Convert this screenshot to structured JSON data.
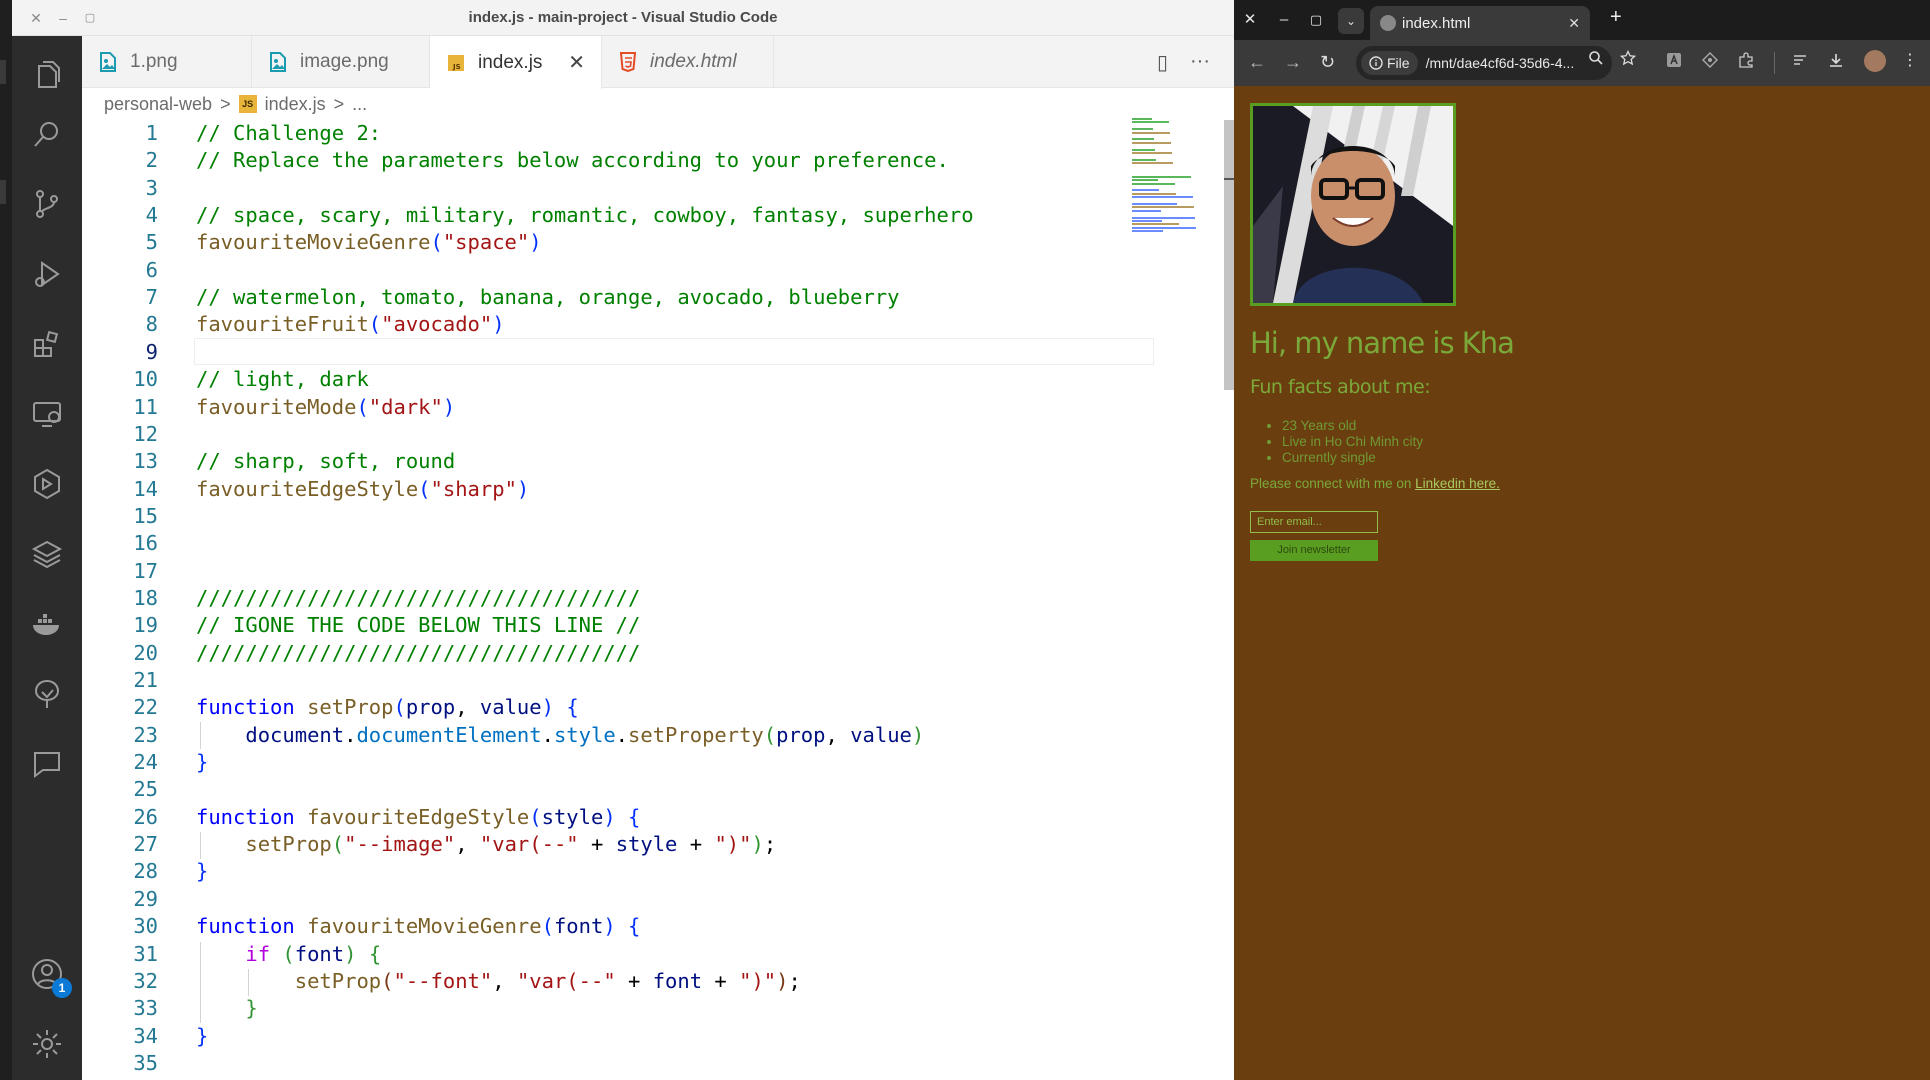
{
  "window": {
    "title": "index.js - main-project - Visual Studio Code",
    "controls": {
      "close": "✕",
      "minimize": "–",
      "maximize": "▢"
    }
  },
  "activity_bar": {
    "icons": [
      "files-icon",
      "search-icon",
      "source-control-icon",
      "run-debug-icon",
      "extensions-icon",
      "remote-explorer-icon",
      "testing-icon",
      "layers-icon",
      "docker-icon",
      "tree-icon",
      "chat-icon"
    ],
    "account_badge": "1"
  },
  "tabs": [
    {
      "label": "1.png",
      "icon": "image-file-icon",
      "active": false,
      "italic": false
    },
    {
      "label": "image.png",
      "icon": "image-file-icon",
      "active": false,
      "italic": false
    },
    {
      "label": "index.js",
      "icon": "js-file-icon",
      "active": true,
      "italic": false,
      "close": "✕"
    },
    {
      "label": "index.html",
      "icon": "html-file-icon",
      "active": false,
      "italic": true
    }
  ],
  "tab_actions": {
    "split": "▯",
    "more": "···"
  },
  "breadcrumb": {
    "folder": "personal-web",
    "file": "index.js",
    "rest": "...",
    "sep": ">",
    "js_badge": "JS"
  },
  "editor": {
    "current_line": 9,
    "lines": [
      {
        "n": "1",
        "html": "<span class='c-com'>// Challenge 2:</span>"
      },
      {
        "n": "2",
        "html": "<span class='c-com'>// Replace the parameters below according to your preference.</span>"
      },
      {
        "n": "3",
        "html": ""
      },
      {
        "n": "4",
        "html": "<span class='c-com'>// space, scary, military, romantic, cowboy, fantasy, superhero</span>"
      },
      {
        "n": "5",
        "html": "<span class='c-fn'>favouriteMovieGenre</span><span class='c-b1'>(</span><span class='c-str'>\"space\"</span><span class='c-b1'>)</span>"
      },
      {
        "n": "6",
        "html": ""
      },
      {
        "n": "7",
        "html": "<span class='c-com'>// watermelon, tomato, banana, orange, avocado, blueberry</span>"
      },
      {
        "n": "8",
        "html": "<span class='c-fn'>favouriteFruit</span><span class='c-b1'>(</span><span class='c-str'>\"avocado\"</span><span class='c-b1'>)</span>"
      },
      {
        "n": "9",
        "html": ""
      },
      {
        "n": "10",
        "html": "<span class='c-com'>// light, dark</span>"
      },
      {
        "n": "11",
        "html": "<span class='c-fn'>favouriteMode</span><span class='c-b1'>(</span><span class='c-str'>\"dark\"</span><span class='c-b1'>)</span>"
      },
      {
        "n": "12",
        "html": ""
      },
      {
        "n": "13",
        "html": "<span class='c-com'>// sharp, soft, round</span>"
      },
      {
        "n": "14",
        "html": "<span class='c-fn'>favouriteEdgeStyle</span><span class='c-b1'>(</span><span class='c-str'>\"sharp\"</span><span class='c-b1'>)</span>"
      },
      {
        "n": "15",
        "html": ""
      },
      {
        "n": "16",
        "html": ""
      },
      {
        "n": "17",
        "html": ""
      },
      {
        "n": "18",
        "html": "<span class='c-com'>////////////////////////////////////</span>"
      },
      {
        "n": "19",
        "html": "<span class='c-com'>// IGONE THE CODE BELOW THIS LINE //</span>"
      },
      {
        "n": "20",
        "html": "<span class='c-com'>////////////////////////////////////</span>"
      },
      {
        "n": "21",
        "html": ""
      },
      {
        "n": "22",
        "html": "<span class='c-kw'>function</span> <span class='c-fn'>setProp</span><span class='c-b1'>(</span><span class='c-var'>prop</span>, <span class='c-var'>value</span><span class='c-b1'>)</span> <span class='c-b1'>{</span>"
      },
      {
        "n": "23",
        "html": "    <span class='c-var'>document</span>.<span class='c-prop'>documentElement</span>.<span class='c-prop'>style</span>.<span class='c-fn'>setProperty</span><span class='c-b2'>(</span><span class='c-var'>prop</span>, <span class='c-var'>value</span><span class='c-b2'>)</span>"
      },
      {
        "n": "24",
        "html": "<span class='c-b1'>}</span>"
      },
      {
        "n": "25",
        "html": ""
      },
      {
        "n": "26",
        "html": "<span class='c-kw'>function</span> <span class='c-fn'>favouriteEdgeStyle</span><span class='c-b1'>(</span><span class='c-var'>style</span><span class='c-b1'>)</span> <span class='c-b1'>{</span>"
      },
      {
        "n": "27",
        "html": "    <span class='c-fn'>setProp</span><span class='c-b2'>(</span><span class='c-str'>\"--image\"</span>, <span class='c-str'>\"var(--\"</span> + <span class='c-var'>style</span> + <span class='c-str'>\")\"</span><span class='c-b2'>)</span>;"
      },
      {
        "n": "28",
        "html": "<span class='c-b1'>}</span>"
      },
      {
        "n": "29",
        "html": ""
      },
      {
        "n": "30",
        "html": "<span class='c-kw'>function</span> <span class='c-fn'>favouriteMovieGenre</span><span class='c-b1'>(</span><span class='c-var'>font</span><span class='c-b1'>)</span> <span class='c-b1'>{</span>"
      },
      {
        "n": "31",
        "html": "    <span class='c-ctl'>if</span> <span class='c-b2'>(</span><span class='c-var'>font</span><span class='c-b2'>)</span> <span class='c-b2'>{</span>"
      },
      {
        "n": "32",
        "html": "        <span class='c-fn'>setProp</span><span class='c-b3'>(</span><span class='c-str'>\"--font\"</span>, <span class='c-str'>\"var(--\"</span> + <span class='c-var'>font</span> + <span class='c-str'>\")\"</span><span class='c-b3'>)</span>;"
      },
      {
        "n": "33",
        "html": "    <span class='c-b2'>}</span>"
      },
      {
        "n": "34",
        "html": "<span class='c-b1'>}</span>"
      },
      {
        "n": "35",
        "html": ""
      }
    ]
  },
  "browser": {
    "window_controls": {
      "close": "✕",
      "minimize": "–",
      "maximize": "▢"
    },
    "tab_dropdown": "⌄",
    "tab_title": "index.html",
    "tab_close": "✕",
    "new_tab": "+",
    "nav": {
      "back": "←",
      "forward": "→",
      "reload": "↻"
    },
    "url_prefix": "File",
    "url": "/mnt/dae4cf6d-35d6-4...",
    "colors": {
      "page_bg": "#6b3e0f",
      "accent": "#7aa93a",
      "button": "#5a9e21"
    }
  },
  "webpage": {
    "heading": "Hi, my name is Kha",
    "subheading": "Fun facts about me:",
    "facts": [
      "23 Years old",
      "Live in Ho Chi Minh city",
      "Currently single"
    ],
    "connect_text": "Please connect with me on",
    "connect_link": "Linkedin here.",
    "email_placeholder": "Enter email...",
    "button_label": "Join newsletter"
  }
}
